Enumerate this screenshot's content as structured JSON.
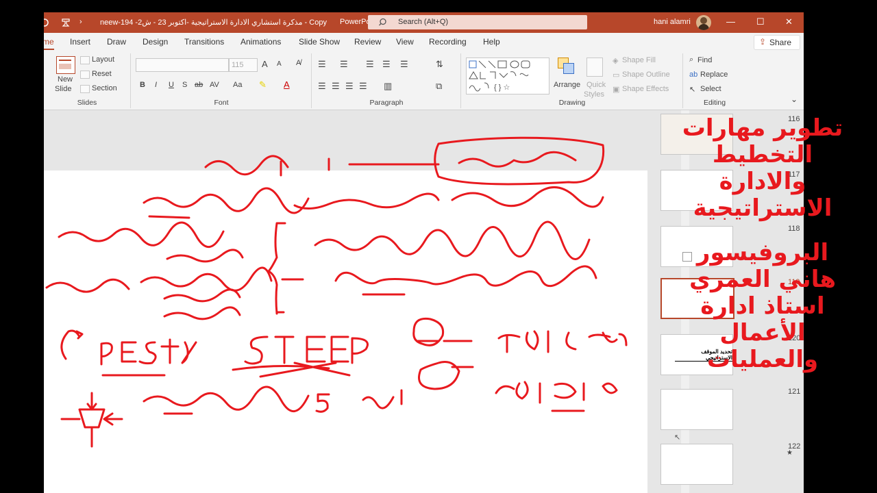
{
  "titlebar": {
    "document_title": "neew-مذكرة استشاري الادارة الاستراتيجية -اكتوبر 23 - ش2- 194 - Copy",
    "app_name": "PowerPoint",
    "search_placeholder": "Search (Alt+Q)",
    "user_name": "hani alamri",
    "min_glyph": "—",
    "max_glyph": "☐",
    "close_glyph": "✕"
  },
  "tabs": [
    "me",
    "Insert",
    "Draw",
    "Design",
    "Transitions",
    "Animations",
    "Slide Show",
    "Review",
    "View",
    "Recording",
    "Help"
  ],
  "share_label": "Share",
  "ribbon": {
    "slides": {
      "new_slide": "New",
      "new_slide2": "Slide",
      "layout": "Layout",
      "reset": "Reset",
      "section": "Section",
      "label": "Slides"
    },
    "font": {
      "font_size": "115",
      "bold": "B",
      "italic": "I",
      "underline": "U",
      "shadow": "S",
      "strike": "ab",
      "spacing": "AV",
      "case": "Aa",
      "grow": "A",
      "shrink": "A",
      "label": "Font"
    },
    "paragraph": {
      "label": "Paragraph"
    },
    "drawing": {
      "arrange": "Arrange",
      "quick_styles": "Quick",
      "quick_styles2": "Styles",
      "shape_fill": "Shape Fill",
      "shape_outline": "Shape Outline",
      "shape_effects": "Shape Effects",
      "label": "Drawing"
    },
    "editing": {
      "find": "Find",
      "replace": "Replace",
      "select": "Select",
      "label": "Editing"
    }
  },
  "thumbnails": [
    {
      "number": "116"
    },
    {
      "number": "117"
    },
    {
      "number": "118"
    },
    {
      "number": "119",
      "selected": true
    },
    {
      "number": "120",
      "caption": "تحديد الموقف الاستراتيجي"
    },
    {
      "number": "121"
    },
    {
      "number": "122"
    }
  ],
  "overlay_text": [
    "تطوير مهارات",
    "التخطيط",
    "والادارة",
    "الاستراتيجية",
    "",
    "البروفيسور",
    "هاني العمري",
    "استاذ ادارة",
    "الأعمال",
    "والعمليات"
  ],
  "ink_text": {
    "pest": "PEST",
    "steep": "STEEP",
    "five": "5",
    "num1": "1",
    "num2": "2"
  },
  "colors": {
    "accent": "#b7472a",
    "ink": "#e8191e",
    "overlay": "#e8191e"
  }
}
